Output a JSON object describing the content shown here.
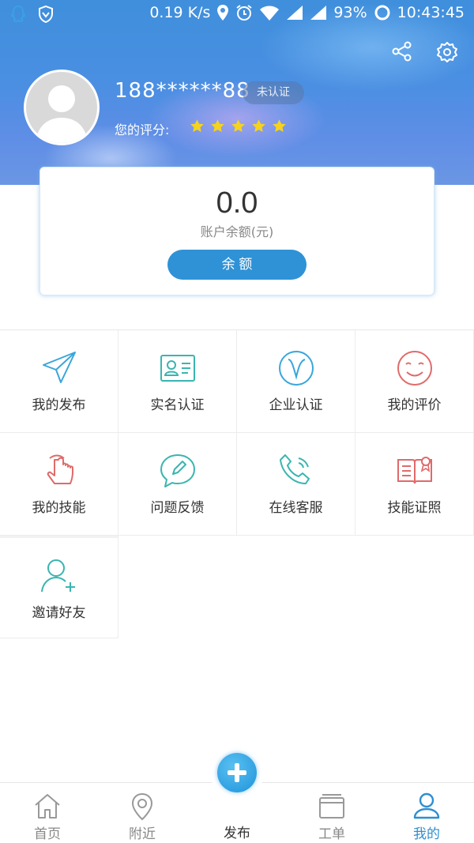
{
  "statusbar": {
    "network_speed": "0.19 K/s",
    "battery": "93%",
    "time": "10:43:45",
    "icons": [
      "qq-icon",
      "vpn-shield-icon",
      "location-icon",
      "alarm-icon",
      "wifi-icon",
      "signal-icon",
      "signal-icon",
      "sync-circle-icon"
    ]
  },
  "profile": {
    "phone": "188******88",
    "verify_badge": "未认证",
    "rating_label": "您的评分:",
    "rating_stars": 5,
    "rating_max": 5
  },
  "balance": {
    "amount": "0.0",
    "label": "账户余额(元)",
    "button_label": "余 额"
  },
  "grid": {
    "items": [
      {
        "label": "我的发布",
        "icon": "send-arrow-icon"
      },
      {
        "label": "实名认证",
        "icon": "id-card-icon"
      },
      {
        "label": "企业认证",
        "icon": "v-badge-icon"
      },
      {
        "label": "我的评价",
        "icon": "smiley-icon"
      },
      {
        "label": "我的技能",
        "icon": "hand-touch-icon"
      },
      {
        "label": "问题反馈",
        "icon": "feedback-bubble-icon"
      },
      {
        "label": "在线客服",
        "icon": "phone-call-icon"
      },
      {
        "label": "技能证照",
        "icon": "certificate-book-icon"
      },
      {
        "label": "邀请好友",
        "icon": "add-friend-icon"
      }
    ]
  },
  "nav": {
    "items": [
      {
        "label": "首页",
        "icon": "home-icon"
      },
      {
        "label": "附近",
        "icon": "map-pin-icon"
      },
      {
        "label": "发布",
        "icon": "plus-circle-icon"
      },
      {
        "label": "工单",
        "icon": "work-order-icon"
      },
      {
        "label": "我的",
        "icon": "user-icon"
      }
    ],
    "active": "我的"
  },
  "colors": {
    "accent": "#2f92d6",
    "star": "#f5d31e",
    "teal_icon": "#3ab5b0",
    "blue_icon": "#3aa6da",
    "red_icon": "#e06a6a"
  }
}
